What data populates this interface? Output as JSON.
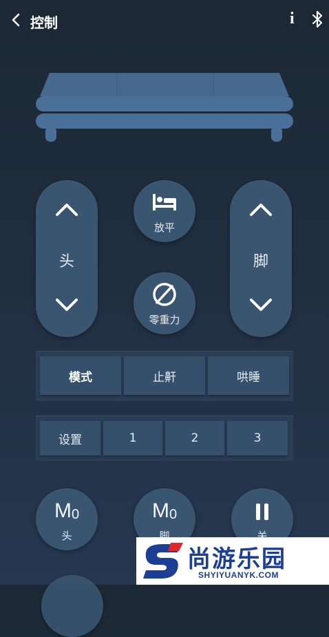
{
  "header": {
    "back_icon": "chevron-left-icon",
    "title": "控制",
    "info_label": "i",
    "bluetooth_icon": "bluetooth-icon"
  },
  "head_control": {
    "label": "头",
    "up_icon": "chevron-up-icon",
    "down_icon": "chevron-down-icon"
  },
  "foot_control": {
    "label": "脚",
    "up_icon": "chevron-up-icon",
    "down_icon": "chevron-down-icon"
  },
  "flat_button": {
    "label": "放平",
    "icon": "bed-icon"
  },
  "zero_gravity_button": {
    "label": "零重力",
    "icon": "zero-gravity-icon"
  },
  "mode_tabs": [
    {
      "label": "模式",
      "active": true
    },
    {
      "label": "止鼾",
      "active": false
    },
    {
      "label": "哄睡",
      "active": false
    }
  ],
  "preset_row": {
    "items": [
      {
        "label": "设置"
      },
      {
        "label": "1"
      },
      {
        "label": "2"
      },
      {
        "label": "3"
      }
    ]
  },
  "memory_buttons": [
    {
      "big": "M",
      "sub": "0",
      "small": "头"
    },
    {
      "big": "M",
      "sub": "0",
      "small": "脚"
    },
    {
      "big": "",
      "sub": "",
      "small": "关",
      "icon": "pause-icon"
    }
  ],
  "watermark": {
    "text": "尚游乐园",
    "url": "SHYIYUANYK.COM",
    "brand_color": "#1c3f93",
    "accent_color": "#e02a2a"
  },
  "colors": {
    "button_fill": "#3a5570",
    "panel_fill": "#2b3e55",
    "segment_fill": "#36506c"
  }
}
